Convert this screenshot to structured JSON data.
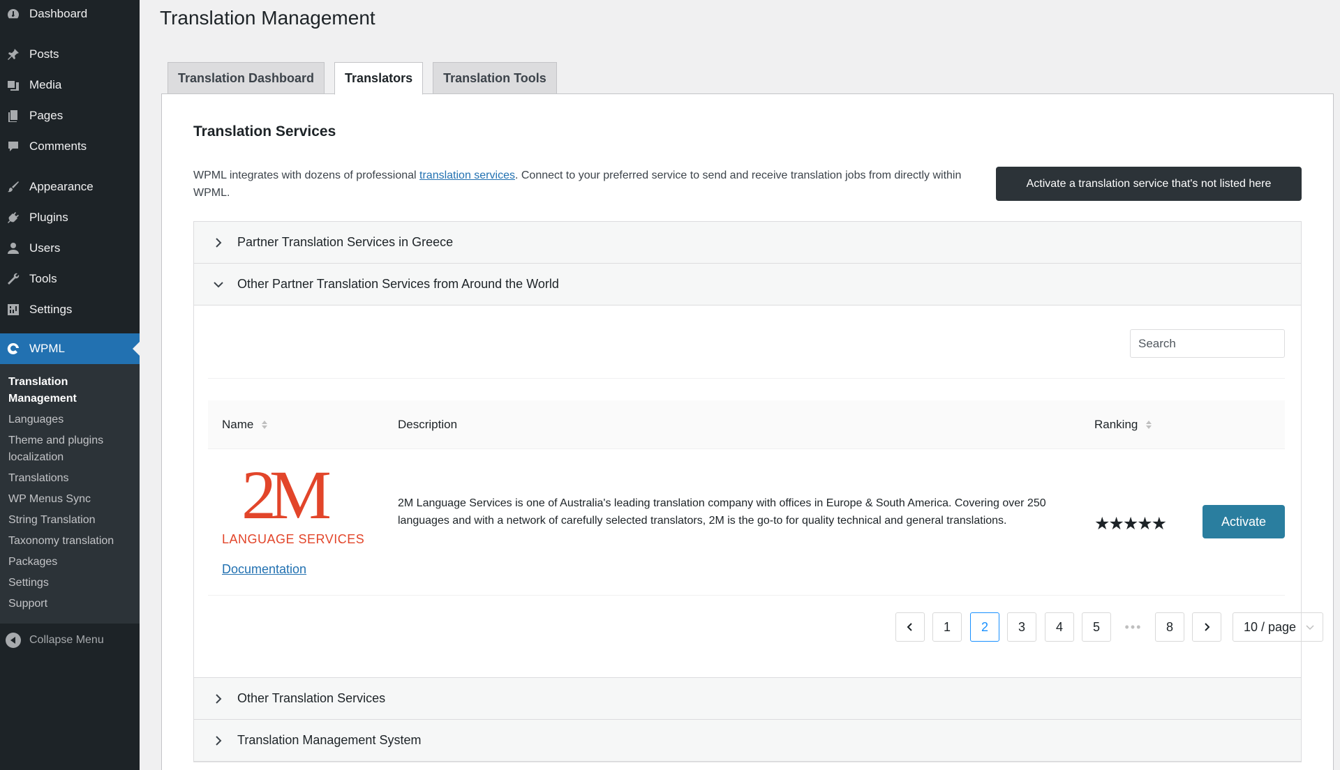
{
  "sidebar": {
    "items": [
      {
        "label": "Dashboard",
        "icon": "dashboard-icon"
      },
      {
        "label": "Posts",
        "icon": "pin-icon"
      },
      {
        "label": "Media",
        "icon": "media-icon"
      },
      {
        "label": "Pages",
        "icon": "pages-icon"
      },
      {
        "label": "Comments",
        "icon": "comment-icon"
      },
      {
        "label": "Appearance",
        "icon": "brush-icon"
      },
      {
        "label": "Plugins",
        "icon": "plug-icon"
      },
      {
        "label": "Users",
        "icon": "user-icon"
      },
      {
        "label": "Tools",
        "icon": "wrench-icon"
      },
      {
        "label": "Settings",
        "icon": "sliders-icon"
      },
      {
        "label": "WPML",
        "icon": "wpml-icon"
      }
    ],
    "submenu": [
      "Translation Management",
      "Languages",
      "Theme and plugins localization",
      "Translations",
      "WP Menus Sync",
      "String Translation",
      "Taxonomy translation",
      "Packages",
      "Settings",
      "Support"
    ],
    "collapse_label": "Collapse Menu"
  },
  "page": {
    "title": "Translation Management",
    "tabs": [
      "Translation Dashboard",
      "Translators",
      "Translation Tools"
    ],
    "active_tab": "Translators"
  },
  "services": {
    "title": "Translation Services",
    "intro_before": "WPML integrates with dozens of professional ",
    "intro_link": "translation services",
    "intro_after": ". Connect to your preferred service to send and receive translation jobs from directly within WPML.",
    "activate_other_label": "Activate a translation service that's not listed here",
    "sections": [
      {
        "label": "Partner Translation Services in Greece",
        "expanded": false
      },
      {
        "label": "Other Partner Translation Services from Around the World",
        "expanded": true
      },
      {
        "label": "Other Translation Services",
        "expanded": false
      },
      {
        "label": "Translation Management System",
        "expanded": false
      }
    ],
    "search_placeholder": "Search",
    "table": {
      "columns": [
        "Name",
        "Description",
        "Ranking"
      ],
      "rows": [
        {
          "logo_main": "2M",
          "logo_sub": "LANGUAGE SERVICES",
          "doc_label": "Documentation",
          "description": "2M Language Services is one of Australia's leading translation company with offices in Europe & South America. Covering over 250 languages and with a network of carefully selected translators, 2M is the go-to for quality technical and general translations.",
          "stars": "★★★★★",
          "rating": 5,
          "action_label": "Activate"
        }
      ]
    },
    "pagination": {
      "pages": [
        "1",
        "2",
        "3",
        "4",
        "5",
        "•••",
        "8"
      ],
      "current": "2",
      "page_size": "10 / page"
    }
  },
  "colors": {
    "sidebar_bg": "#1d2327",
    "wp_blue": "#2271b1",
    "activate_btn": "#2a7e9f",
    "logo_red": "#e2452a"
  }
}
